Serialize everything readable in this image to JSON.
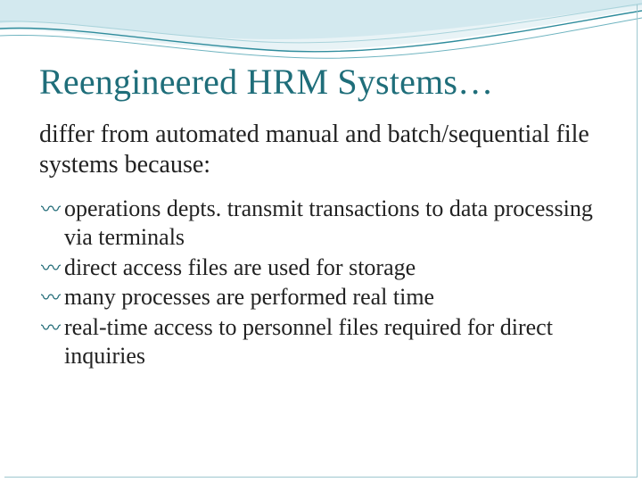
{
  "title": "Reengineered HRM Systems…",
  "subtitle": "differ from automated manual and batch/sequential file systems because:",
  "bullets": [
    "operations depts. transmit transactions to data processing via terminals",
    "direct access files are used for storage",
    "many processes are performed real time",
    "real-time access to personnel files required for direct inquiries"
  ]
}
